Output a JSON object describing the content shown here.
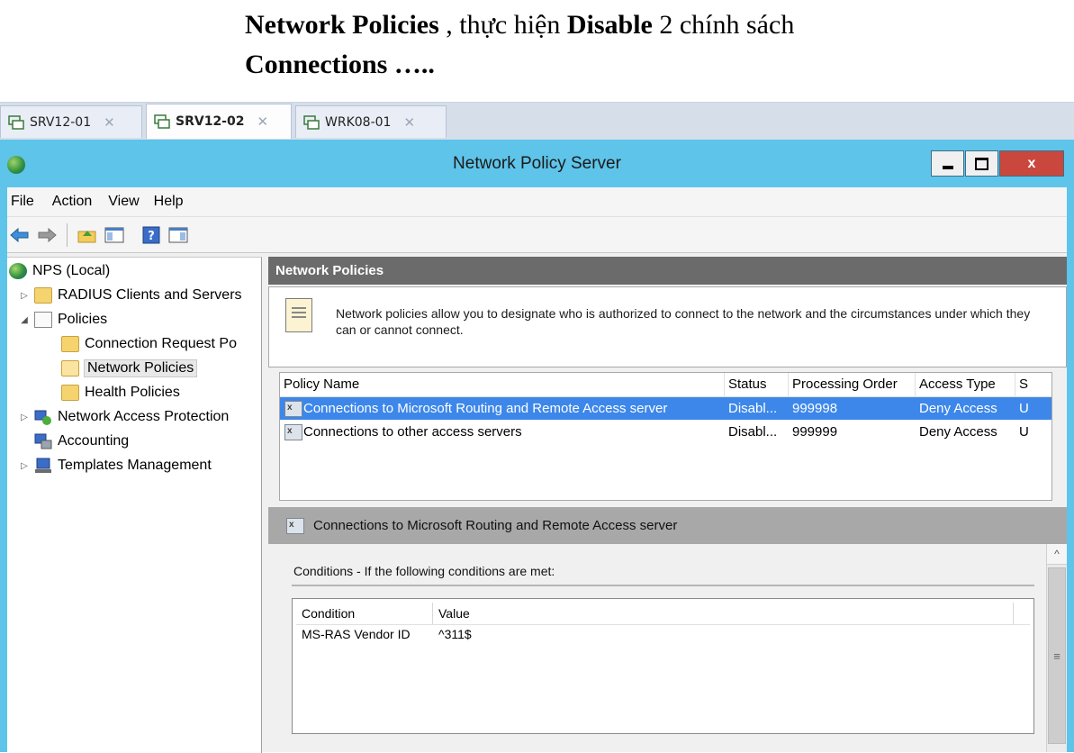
{
  "caption": {
    "line1_bold_a": "Network Policies",
    "line1_mid": " , thực hiện ",
    "line1_bold_b": "Disable",
    "line1_tail": " 2 chính sách",
    "line2": "Connections ….."
  },
  "vm_tabs": [
    {
      "label": "SRV12-01",
      "active": false
    },
    {
      "label": "SRV12-02",
      "active": true
    },
    {
      "label": "WRK08-01",
      "active": false
    }
  ],
  "window": {
    "title": "Network Policy Server",
    "close_glyph": "x"
  },
  "menu": [
    "File",
    "Action",
    "View",
    "Help"
  ],
  "toolbar_icons": [
    "back-arrow-icon",
    "forward-arrow-icon",
    "up-folder-icon",
    "show-hide-tree-icon",
    "help-icon",
    "action-pane-icon"
  ],
  "tree": [
    {
      "label": "NPS (Local)",
      "icon": "globe-icon",
      "expander": ""
    },
    {
      "label": "RADIUS Clients and Servers",
      "icon": "folder-icon",
      "expander": "▷"
    },
    {
      "label": "Policies",
      "icon": "document-icon",
      "expander": "◢"
    },
    {
      "label": "Connection Request Po",
      "icon": "folder-icon",
      "expander": ""
    },
    {
      "label": "Network Policies",
      "icon": "open-folder-icon",
      "expander": "",
      "selected": true
    },
    {
      "label": "Health Policies",
      "icon": "folder-icon",
      "expander": ""
    },
    {
      "label": "Network Access Protection",
      "icon": "nap-icon",
      "expander": "▷"
    },
    {
      "label": "Accounting",
      "icon": "accounting-icon",
      "expander": ""
    },
    {
      "label": "Templates Management",
      "icon": "templates-icon",
      "expander": "▷"
    }
  ],
  "pane": {
    "header": "Network Policies",
    "description": "Network policies allow you to designate who is authorized to connect to the network and the circumstances under which they can or cannot connect.",
    "columns": [
      "Policy Name",
      "Status",
      "Processing Order",
      "Access Type",
      "S"
    ],
    "rows": [
      {
        "name": "Connections to Microsoft Routing and Remote Access server",
        "status": "Disabl...",
        "order": "999998",
        "access": "Deny Access",
        "s": "U",
        "selected": true
      },
      {
        "name": "Connections to other access servers",
        "status": "Disabl...",
        "order": "999999",
        "access": "Deny Access",
        "s": "U",
        "selected": false
      }
    ],
    "detail_title": "Connections to Microsoft Routing and Remote Access server",
    "conditions_label": "Conditions - If the following conditions are met:",
    "cond_columns": [
      "Condition",
      "Value"
    ],
    "cond_rows": [
      {
        "condition": "MS-RAS Vendor ID",
        "value": "^311$"
      }
    ],
    "scroll_up_glyph": "^",
    "scroll_thumb_glyph": "≡"
  },
  "colors": {
    "title_bar": "#5fc4e9",
    "close_button": "#c9473c",
    "selection": "#3d87ea",
    "pane_header": "#6b6b6b",
    "detail_header": "#a8a8a8"
  }
}
